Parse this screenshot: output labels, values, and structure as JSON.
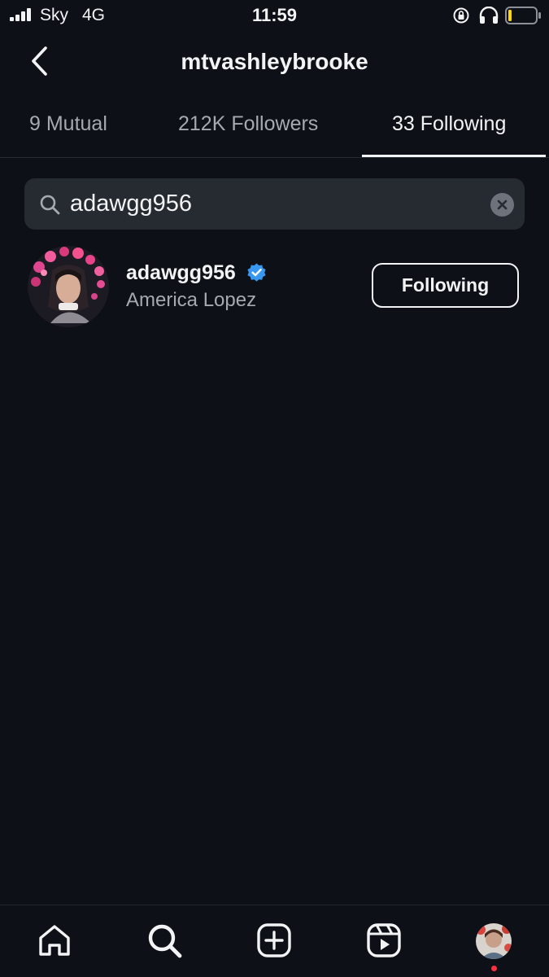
{
  "status_bar": {
    "carrier": "Sky",
    "network": "4G",
    "time": "11:59",
    "signal_icon": "signal-bars-icon",
    "rotation_lock_icon": "rotation-lock-icon",
    "headphones_icon": "headphones-icon",
    "battery_icon": "battery-low-icon",
    "battery_color": "#ffd60a"
  },
  "header": {
    "title": "mtvashleybrooke",
    "back_icon": "chevron-left-icon"
  },
  "tabs": [
    {
      "label": "9 Mutual",
      "active": false
    },
    {
      "label": "212K Followers",
      "active": false
    },
    {
      "label": "33 Following",
      "active": true
    }
  ],
  "search": {
    "value": "adawgg956",
    "icon": "search-icon",
    "clear_icon": "clear-icon"
  },
  "results": [
    {
      "username": "adawgg956",
      "verified": true,
      "verified_color": "#3897f0",
      "full_name": "America Lopez",
      "button_label": "Following"
    }
  ],
  "bottom_nav": {
    "items": [
      "home-icon",
      "search-icon",
      "create-icon",
      "reels-icon",
      "profile-avatar"
    ],
    "notification_dot_color": "#ff3040"
  },
  "colors": {
    "background": "#0d1016",
    "search_field": "#262a31",
    "secondary_text": "#a6a9b0",
    "primary_text": "#f2f3f5"
  }
}
